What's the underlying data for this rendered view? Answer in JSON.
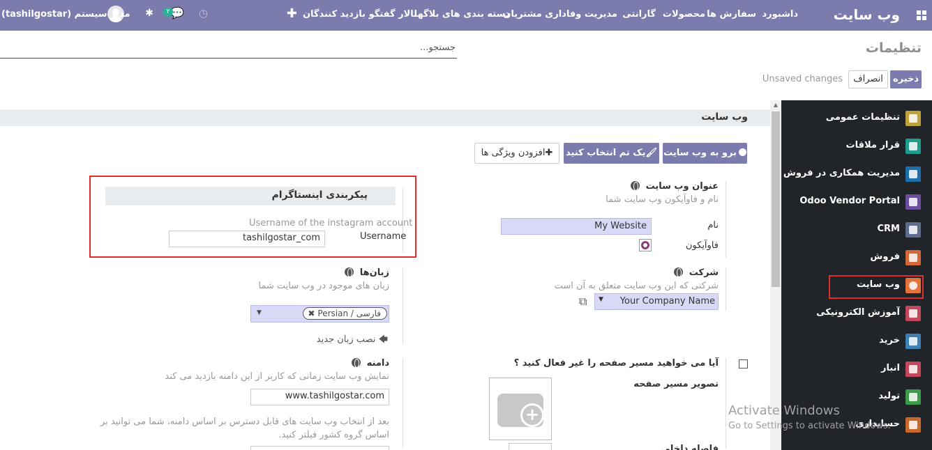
{
  "navbar": {
    "brand": "وب سایت",
    "menu": [
      "داشبورد",
      "سفارش ها",
      "محصولات",
      "گارانتی",
      "مدیریت وفاداری مشتریان",
      "دسته بندی های بلاگها",
      "تالار گفتگو",
      "بازدید کنندگان"
    ],
    "plus_icon": "plus-icon",
    "clock_icon": "clock-icon",
    "chat_badge": "۲",
    "user_name": "مدیر سیستم (tashilgostar)",
    "accent_color": "#7c7bad"
  },
  "control_panel": {
    "title": "تنظیمات",
    "search_placeholder": "جستجو...",
    "save_label": "ذخیره",
    "cancel_label": "انصراف",
    "unsaved_text": "Unsaved changes"
  },
  "sidebar": {
    "items": [
      {
        "label": "تنظیمات عمومی",
        "color": "#c0a23b"
      },
      {
        "label": "قرار ملاقات",
        "color": "#1f9a8b"
      },
      {
        "label": "مدیریت همکاری در فروش",
        "color": "#1c6fa8"
      },
      {
        "label": "Odoo Vendor Portal",
        "color": "#6b4ea0"
      },
      {
        "label": "CRM",
        "color": "#5e6c8e"
      },
      {
        "label": "فروش",
        "color": "#d3683a"
      },
      {
        "label": "وب سایت",
        "color": "#e4723b"
      },
      {
        "label": "آموزش الکترونیکی",
        "color": "#c04a5c"
      },
      {
        "label": "خرید",
        "color": "#3f81b5"
      },
      {
        "label": "انبار",
        "color": "#c2475a"
      },
      {
        "label": "تولید",
        "color": "#3d9a4b"
      },
      {
        "label": "حسابداری",
        "color": "#c9682c"
      }
    ]
  },
  "website_section": {
    "title": "وب سایت",
    "go_to_website": "برو به وب سایت",
    "pick_theme": "یک تم انتخاب کنید",
    "add_features": "افزودن ویژگی ها"
  },
  "website_title": {
    "title": "عنوان وب سایت",
    "desc": "نام و فاوآیکون وب سایت شما",
    "name_label": "نام",
    "name_value": "My Website",
    "favicon_label": "فاوآیکون"
  },
  "instagram": {
    "title": "پیکربندی اینستاگرام",
    "username_help": "Username of the instagram account",
    "username_label": "Username",
    "username_value": "tashilgostar_com"
  },
  "company": {
    "title": "شرکت",
    "desc": "شرکتی که این وب سایت متعلق به آن است",
    "value": "Your Company Name"
  },
  "languages": {
    "title": "زبان‌ها",
    "desc": "زبان های موجود در وب سایت شما",
    "tag": "Persian / فارسی",
    "install_link": "نصب زبان جدید"
  },
  "domain": {
    "title": "دامنه",
    "desc": "نمایش وب سایت زمانی که کاربر از این دامنه بازدید می کند",
    "value": "www.tashilgostar.com",
    "note_line1": "بعد از انتخاب وب سایت های قابل دسترس بر اساس دامنه، شما می توانید بر",
    "note_line2": "اساس گروه کشور فیلتر کنید."
  },
  "page_path": {
    "question": "آیا می خواهید مسیر صفحه را غیر فعال کنید ؟",
    "image_label": "تصویر مسیر صفحه",
    "cut_label": "فاصله داخلی"
  },
  "watermark": {
    "line1": "Activate Windows",
    "line2": "Go to Settings to activate Windows."
  }
}
